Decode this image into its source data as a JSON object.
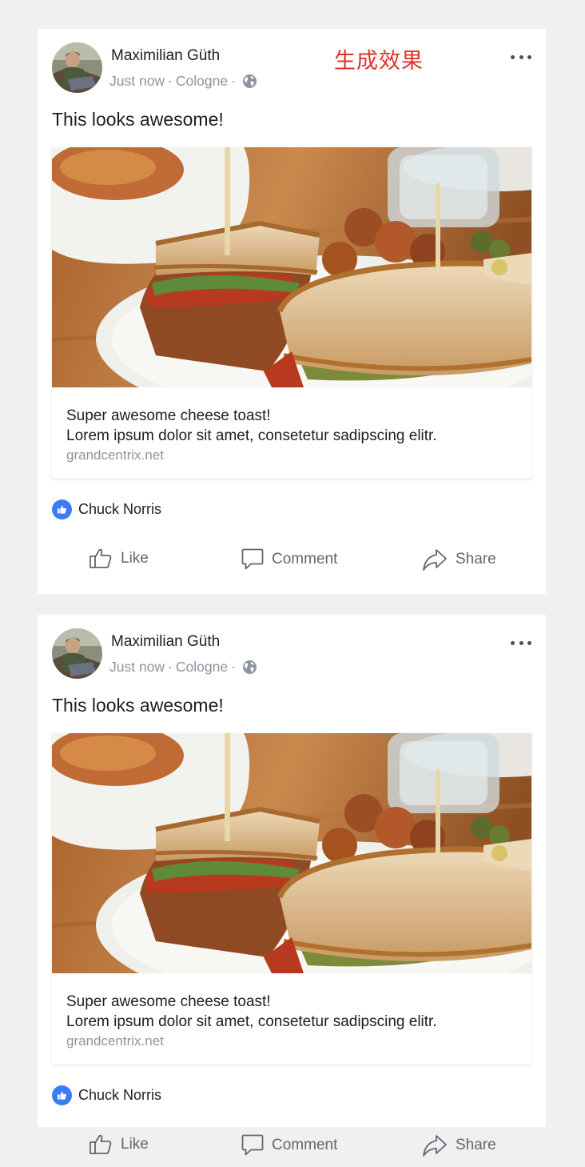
{
  "overlay": {
    "watermark_text": "生成效果"
  },
  "posts": [
    {
      "author": "Maximilian Güth",
      "time": "Just now",
      "separator": "·",
      "location": "Cologne",
      "privacy_icon": "globe-icon",
      "more_icon": "more-options-icon",
      "text": "This looks awesome!",
      "link": {
        "image": "sandwich-photo",
        "title": "Super awesome cheese toast!",
        "description": "Lorem ipsum dolor sit amet, consetetur sadipscing elitr.",
        "domain": "grandcentrix.net"
      },
      "reaction": {
        "icon": "thumbs-up-icon",
        "name": "Chuck Norris"
      },
      "actions": {
        "like": "Like",
        "comment": "Comment",
        "share": "Share"
      }
    },
    {
      "author": "Maximilian Güth",
      "time": "Just now",
      "separator": "·",
      "location": "Cologne",
      "privacy_icon": "globe-icon",
      "more_icon": "more-options-icon",
      "text": "This looks awesome!",
      "link": {
        "image": "sandwich-photo",
        "title": "Super awesome cheese toast!",
        "description": "Lorem ipsum dolor sit amet, consetetur sadipscing elitr.",
        "domain": "grandcentrix.net"
      },
      "reaction": {
        "icon": "thumbs-up-icon",
        "name": "Chuck Norris"
      },
      "actions": {
        "like": "Like",
        "comment": "Comment",
        "share": "Share"
      }
    }
  ],
  "colors": {
    "background": "#f0f0f0",
    "card": "#ffffff",
    "watermark": "#e0322b",
    "like_badge": "#3b7cf5",
    "secondary_text": "#8d949e",
    "action_text": "#606770"
  }
}
